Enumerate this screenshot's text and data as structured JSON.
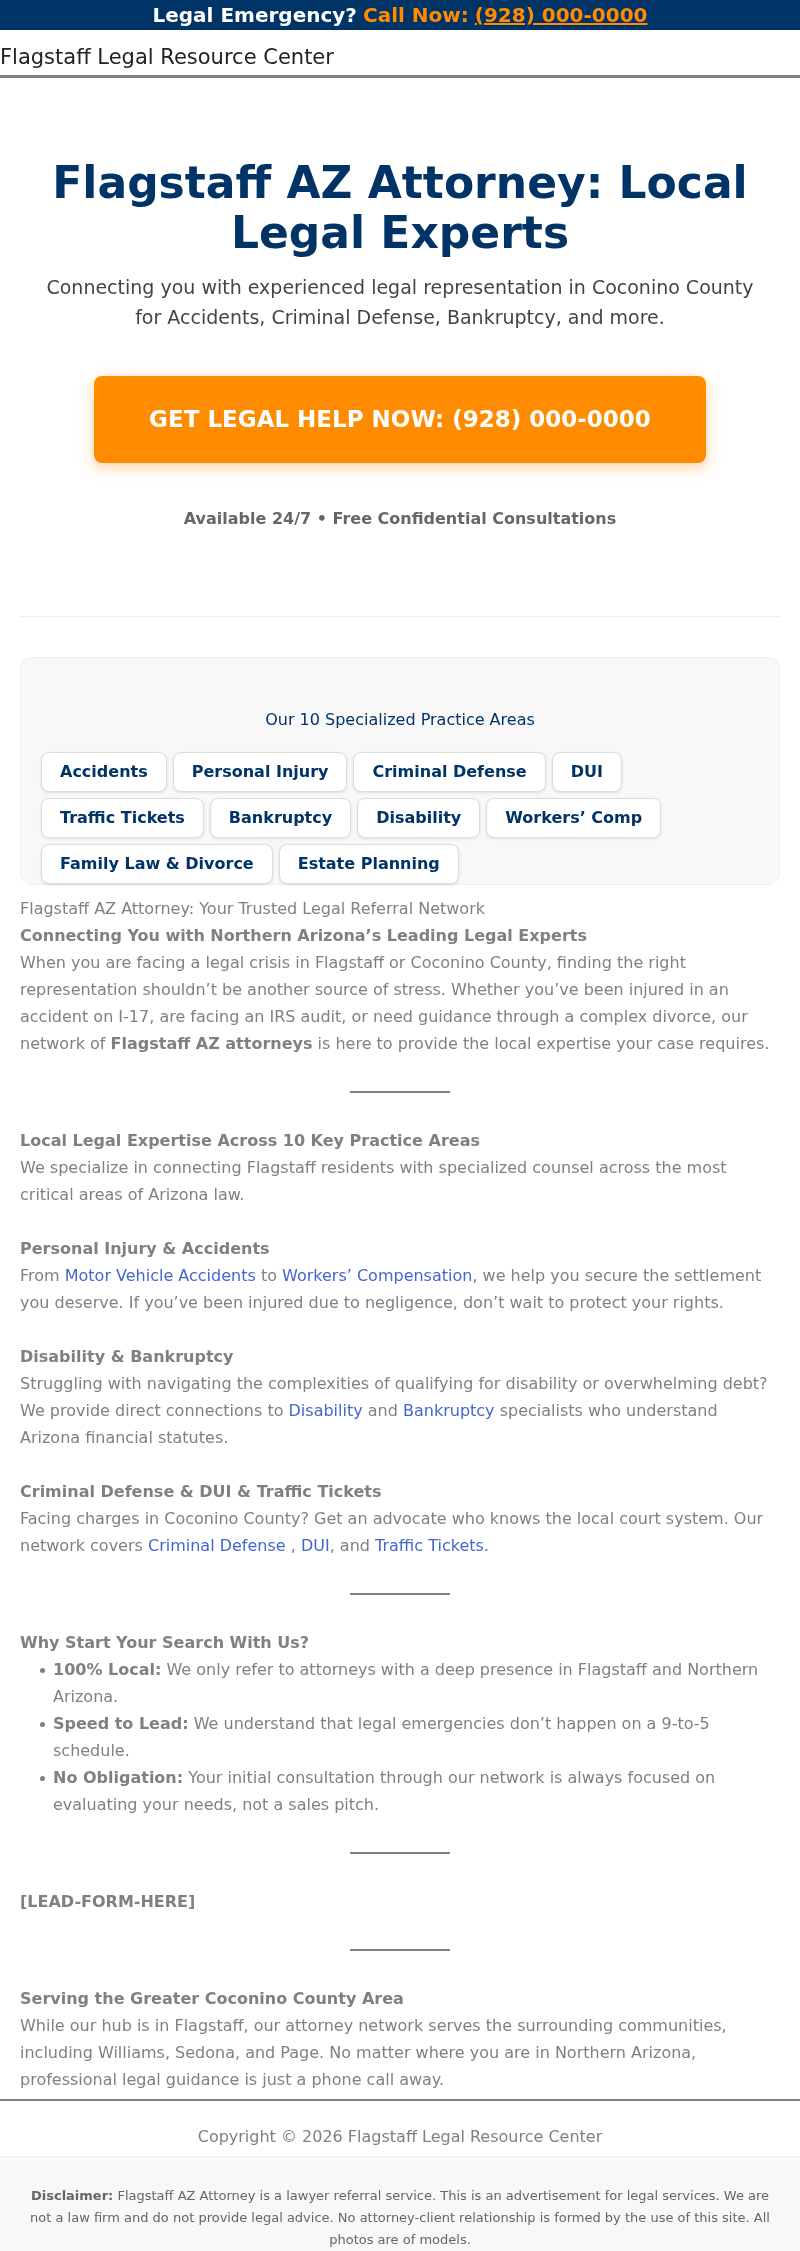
{
  "top_bar": {
    "question": "Legal Emergency?",
    "call_label": "Call Now:",
    "phone": "(928) 000-0000"
  },
  "header": {
    "site_name": "Flagstaff Legal Resource Center"
  },
  "hero": {
    "title": "Flagstaff AZ Attorney: Local Legal Experts",
    "subtitle": "Connecting you with experienced legal representation in Coconino County for Accidents, Criminal Defense, Bankruptcy, and more.",
    "cta": "GET LEGAL HELP NOW: (928) 000-0000",
    "note": "Available 24/7 • Free Confidential Consultations"
  },
  "practice_areas": {
    "title": "Our 10 Specialized Practice Areas",
    "items": [
      {
        "label": "Accidents"
      },
      {
        "label": "Personal Injury"
      },
      {
        "label": "Criminal Defense"
      },
      {
        "label": "DUI"
      },
      {
        "label": "Traffic Tickets"
      },
      {
        "label": "Bankruptcy"
      },
      {
        "label": "Disability"
      },
      {
        "label": "Workers’ Comp"
      },
      {
        "label": "Family Law & Divorce"
      },
      {
        "label": "Estate Planning"
      }
    ]
  },
  "content": [
    {
      "kind": "text",
      "text": "Flagstaff AZ Attorney: Your Trusted Legal Referral Network"
    },
    {
      "kind": "heading",
      "text": "Connecting You with Northern Arizona’s Leading Legal Experts"
    },
    {
      "kind": "paragraph",
      "parts": [
        {
          "text": "When you are facing a legal crisis in Flagstaff or Coconino County, finding the right representation shouldn’t be another source of stress. Whether you’ve been injured in an accident on I-17, are facing an IRS audit, or need guidance through a complex divorce, our network of **Flagstaff AZ attorneys** is here to provide the local expertise your case requires."
        }
      ]
    },
    {
      "kind": "rule"
    },
    {
      "kind": "heading",
      "text": "Local Legal Expertise Across 10 Key Practice Areas"
    },
    {
      "kind": "paragraph",
      "parts": [
        {
          "text": "We specialize in connecting Flagstaff residents with specialized counsel across the most critical areas of Arizona law."
        }
      ]
    },
    {
      "kind": "heading",
      "text": "Personal Injury & Accidents"
    },
    {
      "kind": "paragraph",
      "parts": [
        {
          "text": "From "
        },
        {
          "link": "Motor Vehicle Accidents"
        },
        {
          "text": " to "
        },
        {
          "link": "Workers’ Compensation"
        },
        {
          "text": ", we help you secure the settlement you deserve. If you’ve been injured due to negligence, don’t wait to protect your rights."
        }
      ]
    },
    {
      "kind": "heading",
      "text": "Disability & Bankruptcy"
    },
    {
      "kind": "paragraph",
      "parts": [
        {
          "text": "Struggling with navigating the complexities of qualifying for disability or overwhelming debt? We provide direct connections to "
        },
        {
          "link": "Disability"
        },
        {
          "text": " and "
        },
        {
          "link": "Bankruptcy"
        },
        {
          "text": " specialists who understand Arizona financial statutes."
        }
      ]
    },
    {
      "kind": "heading",
      "text": "Criminal Defense & DUI & Traffic Tickets"
    },
    {
      "kind": "paragraph",
      "parts": [
        {
          "text": "Facing charges in Coconino County? Get an advocate who knows the local court system. Our network covers "
        },
        {
          "link": "Criminal Defense"
        },
        {
          "text": " , "
        },
        {
          "link": "DUI"
        },
        {
          "text": ", and "
        },
        {
          "link": "Traffic Tickets."
        }
      ]
    },
    {
      "kind": "rule"
    },
    {
      "kind": "heading",
      "text": "Why Start Your Search With Us?"
    },
    {
      "kind": "bullets",
      "items": [
        "**100% Local:** We only refer to attorneys with a deep presence in Flagstaff and Northern Arizona.",
        "**Speed to Lead:** We understand that legal emergencies don’t happen on a 9-to-5 schedule.",
        "**No Obligation:** Your initial consultation through our network is always focused on evaluating your needs, not a sales pitch."
      ]
    },
    {
      "kind": "rule"
    },
    {
      "kind": "heading",
      "text": "[LEAD-FORM-HERE]"
    },
    {
      "kind": "rule"
    },
    {
      "kind": "heading",
      "text": "Serving the Greater Coconino County Area"
    },
    {
      "kind": "paragraph",
      "parts": [
        {
          "text": "While our hub is in Flagstaff, our attorney network serves the surrounding communities, including Williams, Sedona, and Page. No matter where you are in Northern Arizona, professional legal guidance is just a phone call away."
        }
      ]
    }
  ],
  "footer": {
    "copyright": "Copyright © 2026 Flagstaff Legal Resource Center",
    "disclaimer": "**Disclaimer:** Flagstaff AZ Attorney is a lawyer referral service. This is an advertisement for legal services. We are not a law firm and do not provide legal advice. No attorney-client relationship is formed by the use of this site. All photos are of models."
  }
}
